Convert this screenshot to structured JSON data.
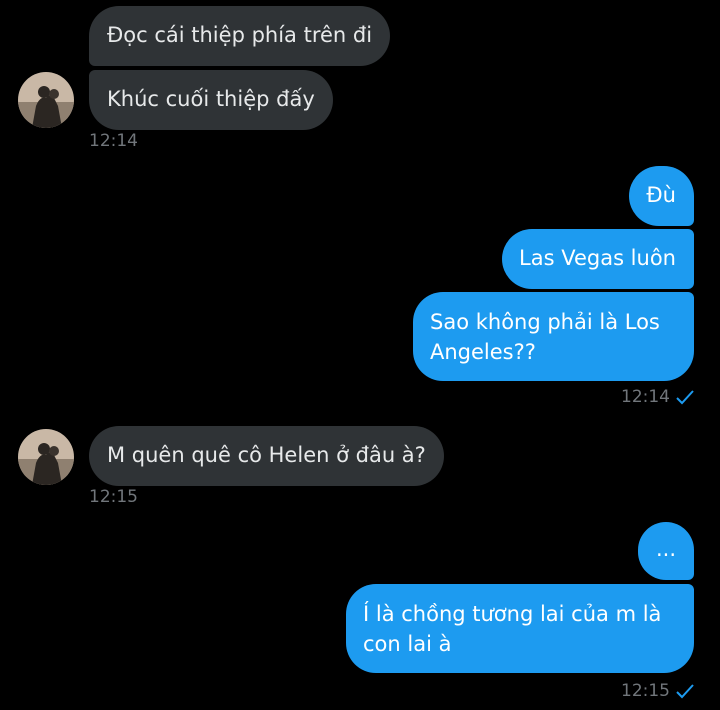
{
  "conversation": {
    "messages": [
      {
        "direction": "incoming",
        "text": "Đọc cái thiệp phía trên đi"
      },
      {
        "direction": "incoming",
        "text": "Khúc cuối thiệp đấy"
      },
      {
        "direction": "outgoing",
        "text": "Đù"
      },
      {
        "direction": "outgoing",
        "text": "Las Vegas luôn"
      },
      {
        "direction": "outgoing",
        "text": "Sao không phải là Los Angeles??"
      },
      {
        "direction": "incoming",
        "text": "M quên quê cô Helen ở đâu à?"
      },
      {
        "direction": "outgoing",
        "text": "..."
      },
      {
        "direction": "outgoing",
        "text": "Í là chồng tương lai của m là con lai à"
      }
    ],
    "timestamps": [
      {
        "direction": "incoming",
        "time": "12:14"
      },
      {
        "direction": "outgoing",
        "time": "12:14",
        "status": "read-check-icon"
      },
      {
        "direction": "incoming",
        "time": "12:15"
      },
      {
        "direction": "outgoing",
        "time": "12:15",
        "status": "read-check-icon"
      }
    ]
  },
  "colors": {
    "background": "#000000",
    "incoming_bubble": "#2f3336",
    "outgoing_bubble": "#1d9bf0",
    "timestamp": "#71767b",
    "check": "#1d9bf0"
  }
}
